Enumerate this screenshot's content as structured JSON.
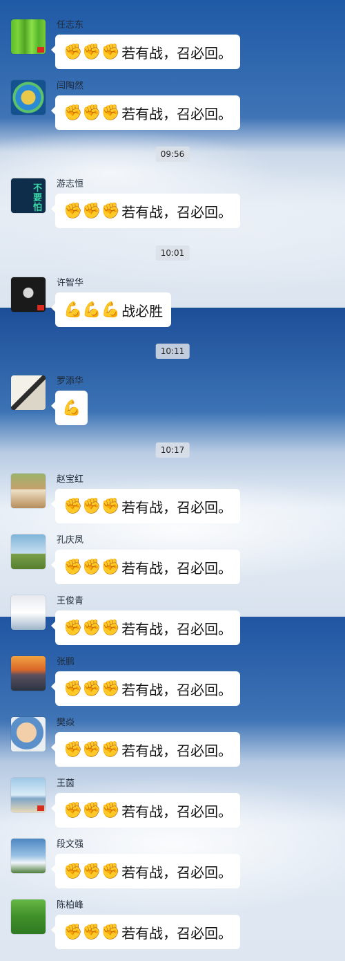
{
  "timestamps": [
    "09:56",
    "10:01",
    "10:11",
    "10:17"
  ],
  "messages": [
    {
      "name": "任志东",
      "emoji": "✊✊✊",
      "text": "若有战，召必回。",
      "avatar": "bamboo-avatar"
    },
    {
      "name": "闫陶然",
      "emoji": "✊✊✊",
      "text": "若有战，召必回。",
      "avatar": "circle-logo-avatar"
    },
    {
      "name": "游志恒",
      "emoji": "✊✊✊",
      "text": "若有战，召必回。",
      "avatar": "cartoon-avatar",
      "avatar_text": "不要怕"
    },
    {
      "name": "许智华",
      "emoji": "💪💪💪",
      "text": "战必胜",
      "avatar": "dark-photo-avatar"
    },
    {
      "name": "罗添华",
      "emoji": "💪",
      "text": "",
      "avatar": "painting-avatar"
    },
    {
      "name": "赵宝红",
      "emoji": "✊✊✊",
      "text": "若有战，召必回。",
      "avatar": "man-photo-avatar"
    },
    {
      "name": "孔庆凤",
      "emoji": "✊✊✊",
      "text": "若有战，召必回。",
      "avatar": "palm-tree-avatar"
    },
    {
      "name": "王俊青",
      "emoji": "✊✊✊",
      "text": "若有战，召必回。",
      "avatar": "woman-photo-avatar"
    },
    {
      "name": "张鹏",
      "emoji": "✊✊✊",
      "text": "若有战，召必回。",
      "avatar": "pier-sunset-avatar"
    },
    {
      "name": "樊焱",
      "emoji": "✊✊✊",
      "text": "若有战，召必回。",
      "avatar": "baby-photo-avatar"
    },
    {
      "name": "王茵",
      "emoji": "✊✊✊",
      "text": "若有战，召必回。",
      "avatar": "beach-avatar"
    },
    {
      "name": "段文强",
      "emoji": "✊✊✊",
      "text": "若有战，召必回。",
      "avatar": "sky-avatar"
    },
    {
      "name": "陈柏峰",
      "emoji": "✊✊✊",
      "text": "若有战，召必回。",
      "avatar": "grass-avatar"
    }
  ]
}
